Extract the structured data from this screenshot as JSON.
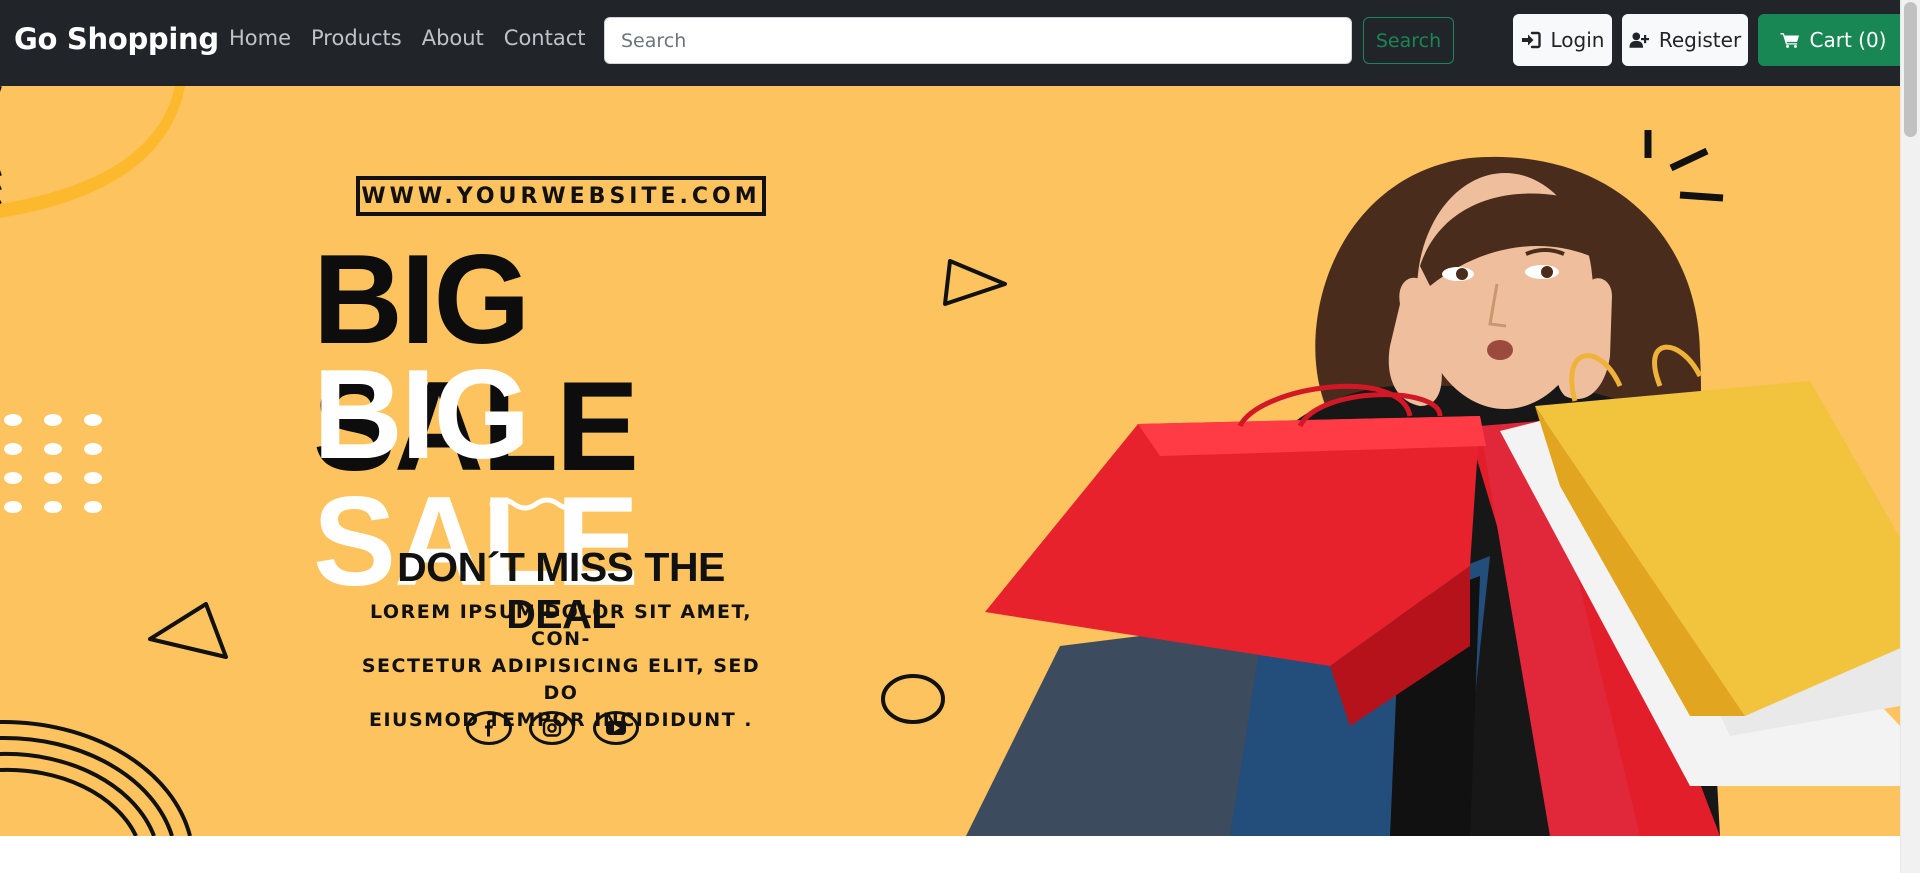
{
  "navbar": {
    "brand": "Go Shopping",
    "links": [
      "Home",
      "Products",
      "About",
      "Contact"
    ],
    "search": {
      "placeholder": "Search",
      "value": "",
      "button_label": "Search"
    },
    "login_label": "Login",
    "register_label": "Register",
    "cart_label": "Cart (0)",
    "colors": {
      "background": "#212529",
      "success": "#198754"
    }
  },
  "hero": {
    "website": "WWW.YOURWEBSITE.COM",
    "headline": "BIG SALE",
    "headline_repeat": "BIG SALE",
    "tagline": "DON´T MISS THE DEAL",
    "body_lines": [
      "LOREM IPSUM DOLOR SIT AMET, CON-",
      "SECTETUR ADIPISICING ELIT, SED DO",
      "EIUSMOD TEMPOR INCIDIDUNT ."
    ],
    "social_icons": [
      "facebook-icon",
      "instagram-icon",
      "youtube-icon"
    ],
    "background_color": "#fcc35f"
  },
  "icons": {
    "login": "sign-in-icon",
    "register": "user-plus-icon",
    "cart": "shopping-cart-icon"
  }
}
